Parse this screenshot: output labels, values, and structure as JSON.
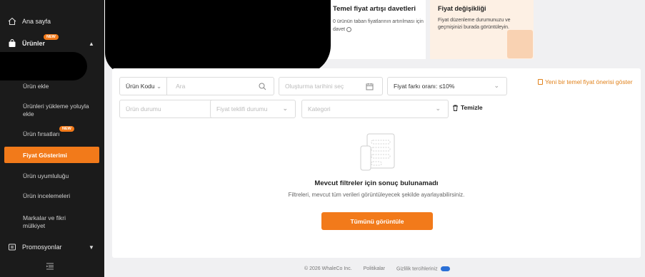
{
  "sidebar": {
    "home": "Ana sayfa",
    "products": "Ürünler",
    "new_badge": "NEW",
    "items": {
      "add_product": "Ürün ekle",
      "bulk_upload": "Ürünleri yükleme yoluyla ekle",
      "opportunities": "Ürün fırsatları",
      "price_display": "Fiyat Gösterimi",
      "compliance": "Ürün uyumluluğu",
      "reviews": "Ürün incelemeleri",
      "brands": "Markalar ve fikri mülkiyet"
    },
    "promotions": "Promosyonlar"
  },
  "cards": {
    "invite_title": "Temel fiyat artışı davetleri",
    "invite_text": "0  ürünün taban fiyatlarının artırılması için davet",
    "change_title": "Fiyat değişikliği",
    "change_text": "Fiyat düzenleme durumunuzu ve geçmişinizi burada görüntüleyin."
  },
  "filters": {
    "product_code": "Ürün Kodu",
    "search_placeholder": "Ara",
    "date_placeholder": "Oluşturma tarihini seç",
    "price_diff": "Fiyat farkı oranı: ≤10%",
    "status_placeholder": "Ürün durumu",
    "offer_status_placeholder": "Fiyat teklifi durumu",
    "category_placeholder": "Kategori",
    "clear": "Temizle",
    "new_suggestion": "Yeni bir temel fiyat önerisi göster"
  },
  "empty": {
    "title": "Mevcut filtreler için sonuç bulunamadı",
    "subtitle": "Filtreleri, mevcut tüm verileri görüntüleyecek şekilde ayarlayabilirsiniz.",
    "button": "Tümünü görüntüle"
  },
  "footer": {
    "copyright": "© 2026 WhaleCo Inc.",
    "policies": "Politikalar",
    "privacy": "Gizlilik tercihleriniz"
  },
  "colors": {
    "accent": "#f27a1a",
    "sidebar_bg": "#1b1b1b"
  }
}
